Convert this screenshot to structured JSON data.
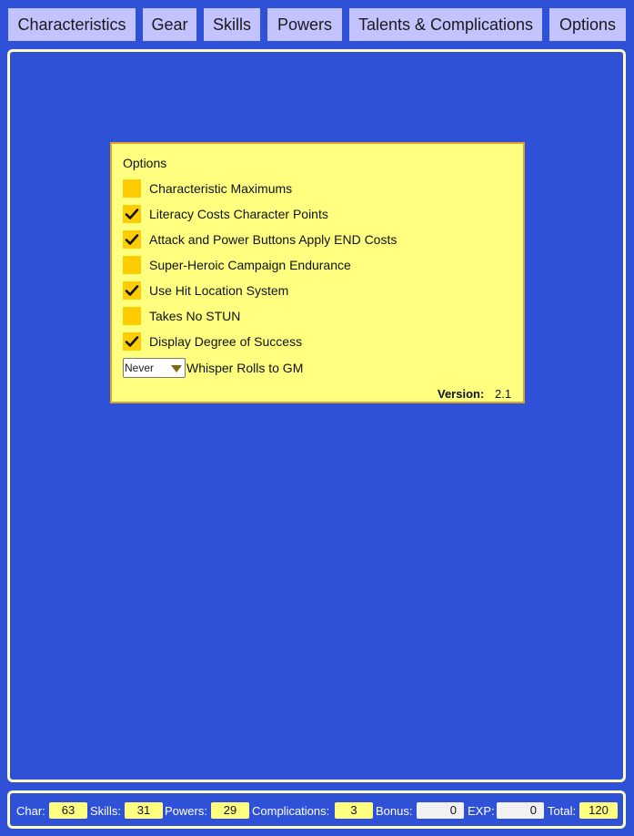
{
  "tabs": [
    {
      "label": "Characteristics"
    },
    {
      "label": "Gear"
    },
    {
      "label": "Skills"
    },
    {
      "label": "Powers"
    },
    {
      "label": "Talents & Complications"
    },
    {
      "label": "Options"
    }
  ],
  "options": {
    "title": "Options",
    "items": [
      {
        "label": "Characteristic Maximums",
        "checked": false
      },
      {
        "label": "Literacy Costs Character Points",
        "checked": true
      },
      {
        "label": "Attack and Power Buttons Apply END Costs",
        "checked": true
      },
      {
        "label": "Super-Heroic Campaign Endurance",
        "checked": false
      },
      {
        "label": "Use Hit Location System",
        "checked": true
      },
      {
        "label": "Takes No STUN",
        "checked": false
      },
      {
        "label": "Display Degree of Success",
        "checked": true
      }
    ],
    "whisper": {
      "selected": "Never",
      "label": "Whisper Rolls to GM"
    },
    "version_label": "Version:",
    "version_value": "2.1",
    "checkbox_color": "#ffcc00",
    "panel_color": "#ffff80"
  },
  "footer": {
    "char_label": "Char:",
    "char_value": "63",
    "skills_label": "Skills:",
    "skills_value": "31",
    "powers_label": "Powers:",
    "powers_value": "29",
    "complications_label": "Complications:",
    "complications_value": "3",
    "bonus_label": "Bonus:",
    "bonus_value": "0",
    "exp_label": "EXP:",
    "exp_value": "0",
    "total_label": "Total:",
    "total_value": "120"
  },
  "colors": {
    "background": "#2f51d8",
    "tab": "#c2c3ff",
    "border": "#fffcc0"
  }
}
